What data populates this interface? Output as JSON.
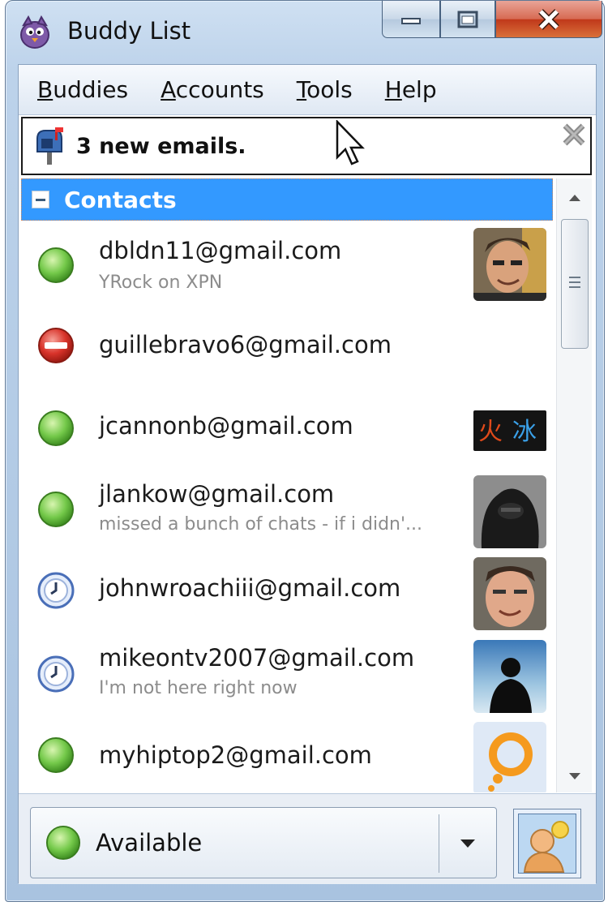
{
  "window": {
    "title": "Buddy List"
  },
  "menu": [
    {
      "underline": "B",
      "rest": "uddies"
    },
    {
      "underline": "A",
      "rest": "ccounts"
    },
    {
      "underline": "T",
      "rest": "ools"
    },
    {
      "underline": "H",
      "rest": "elp"
    }
  ],
  "notice": {
    "text": "3 new emails."
  },
  "group": {
    "label": "Contacts"
  },
  "buddies": [
    {
      "name": "dbldn11@gmail.com",
      "message": "YRock on XPN",
      "status": "available"
    },
    {
      "name": "guillebravo6@gmail.com",
      "message": "",
      "status": "busy"
    },
    {
      "name": "jcannonb@gmail.com",
      "message": "",
      "status": "available"
    },
    {
      "name": "jlankow@gmail.com",
      "message": "missed a bunch of chats - if i didn'...",
      "status": "available"
    },
    {
      "name": "johnwroachiii@gmail.com",
      "message": "",
      "status": "away"
    },
    {
      "name": "mikeontv2007@gmail.com",
      "message": "I'm not here right now",
      "status": "away"
    },
    {
      "name": "myhiptop2@gmail.com",
      "message": "",
      "status": "available"
    }
  ],
  "status_selector": {
    "value": "Available"
  },
  "colors": {
    "selection": "#3399ff",
    "available": "#6cc24a",
    "busy": "#d8332a",
    "away": "#5a7fc8"
  }
}
